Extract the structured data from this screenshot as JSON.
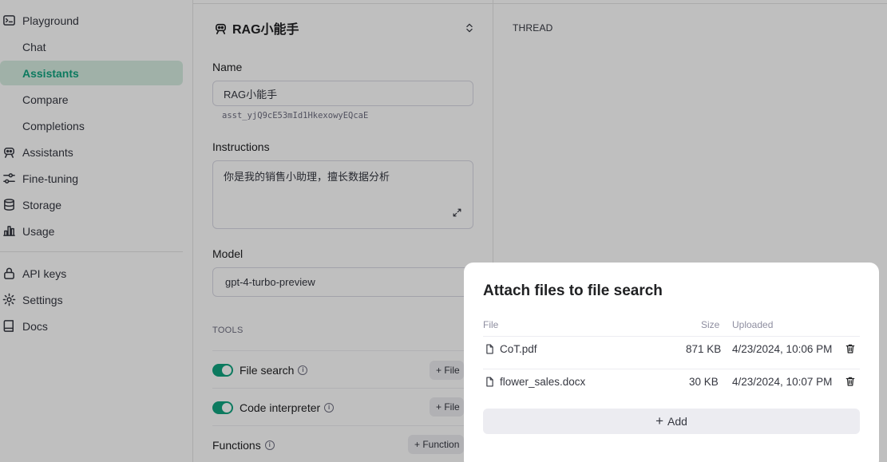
{
  "sidebar": {
    "items": [
      {
        "label": "Playground",
        "icon": "terminal-icon"
      },
      {
        "label": "Chat"
      },
      {
        "label": "Assistants",
        "active": true
      },
      {
        "label": "Compare"
      },
      {
        "label": "Completions"
      },
      {
        "label": "Assistants",
        "icon": "robot-icon"
      },
      {
        "label": "Fine-tuning",
        "icon": "sliders-icon"
      },
      {
        "label": "Storage",
        "icon": "database-icon"
      },
      {
        "label": "Usage",
        "icon": "bar-chart-icon"
      },
      {
        "label": "API keys",
        "icon": "lock-icon"
      },
      {
        "label": "Settings",
        "icon": "gear-icon"
      },
      {
        "label": "Docs",
        "icon": "book-icon"
      }
    ]
  },
  "assistant": {
    "name_header": "RAG小能手",
    "name_label": "Name",
    "name_value": "RAG小能手",
    "assistant_id": "asst_yjQ9cE53mId1HkexowyEQcaE",
    "instructions_label": "Instructions",
    "instructions_value": "你是我的销售小助理，擅长数据分析",
    "model_label": "Model",
    "model_value": "gpt-4-turbo-preview",
    "tools_heading": "TOOLS",
    "tools": [
      {
        "label": "File search",
        "enabled": true,
        "button": "+ File"
      },
      {
        "label": "Code interpreter",
        "enabled": true,
        "button": "+ File"
      }
    ],
    "functions_label": "Functions",
    "functions_button": "+ Function"
  },
  "thread": {
    "label": "THREAD"
  },
  "modal": {
    "title": "Attach files to file search",
    "columns": {
      "file": "File",
      "size": "Size",
      "uploaded": "Uploaded"
    },
    "files": [
      {
        "name": "CoT.pdf",
        "size": "871 KB",
        "uploaded": "4/23/2024, 10:06 PM"
      },
      {
        "name": "flower_sales.docx",
        "size": "30 KB",
        "uploaded": "4/23/2024, 10:07 PM"
      }
    ],
    "add_label": "Add"
  },
  "colors": {
    "accent": "#10a37f",
    "active_bg": "#d6ede1"
  }
}
